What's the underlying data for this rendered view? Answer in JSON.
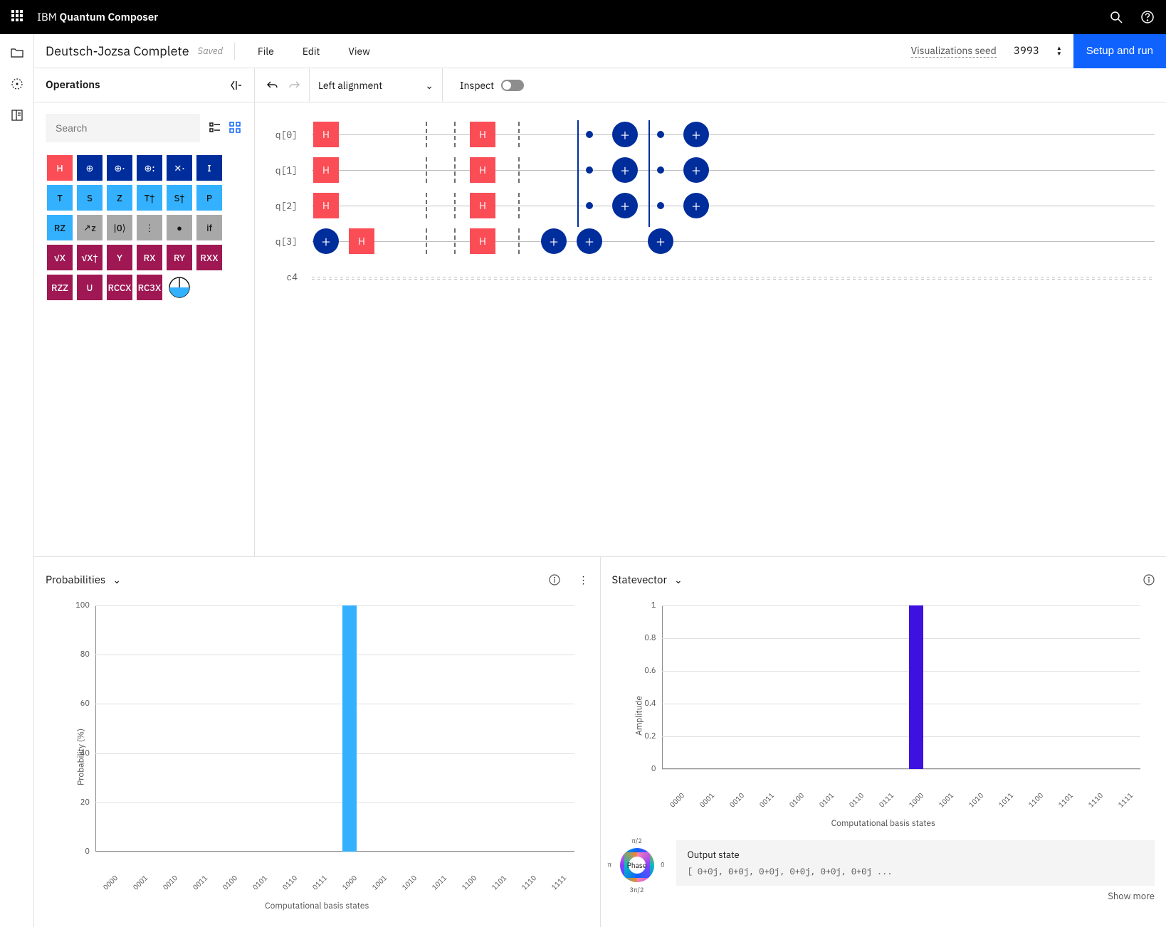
{
  "header": {
    "brand_prefix": "IBM ",
    "brand_main": "Quantum Composer"
  },
  "toolbar": {
    "circuit_name": "Deutsch-Jozsa Complete",
    "saved_label": "Saved",
    "menu": {
      "file": "File",
      "edit": "Edit",
      "view": "View"
    },
    "vis_seed_label": "Visualizations seed",
    "seed_value": "3993",
    "setup_run": "Setup and run"
  },
  "ops": {
    "title": "Operations",
    "search_placeholder": "Search",
    "gates": [
      {
        "l": "H",
        "c": "g-red"
      },
      {
        "l": "⊕",
        "c": "g-navy"
      },
      {
        "l": "⊕·",
        "c": "g-navy"
      },
      {
        "l": "⊕:",
        "c": "g-navy"
      },
      {
        "l": "✕·",
        "c": "g-navy"
      },
      {
        "l": "I",
        "c": "g-navy"
      },
      {
        "l": "T",
        "c": "g-blue"
      },
      {
        "l": "S",
        "c": "g-blue"
      },
      {
        "l": "Z",
        "c": "g-blue"
      },
      {
        "l": "T†",
        "c": "g-blue"
      },
      {
        "l": "S†",
        "c": "g-blue"
      },
      {
        "l": "P",
        "c": "g-blue"
      },
      {
        "l": "RZ",
        "c": "g-blue"
      },
      {
        "l": "↗z",
        "c": "g-grey"
      },
      {
        "l": "|0⟩",
        "c": "g-grey"
      },
      {
        "l": "⋮",
        "c": "g-grey"
      },
      {
        "l": "●",
        "c": "g-grey"
      },
      {
        "l": "if",
        "c": "g-grey"
      },
      {
        "l": "√X",
        "c": "g-mag"
      },
      {
        "l": "√X†",
        "c": "g-mag"
      },
      {
        "l": "Y",
        "c": "g-mag"
      },
      {
        "l": "RX",
        "c": "g-mag"
      },
      {
        "l": "RY",
        "c": "g-mag"
      },
      {
        "l": "RXX",
        "c": "g-mag"
      },
      {
        "l": "RZZ",
        "c": "g-mag"
      },
      {
        "l": "U",
        "c": "g-mag"
      },
      {
        "l": "RCCX",
        "c": "g-mag"
      },
      {
        "l": "RC3X",
        "c": "g-mag"
      }
    ]
  },
  "circuit_toolbar": {
    "alignment": "Left alignment",
    "inspect": "Inspect"
  },
  "circuit": {
    "qubits": [
      "q[0]",
      "q[1]",
      "q[2]",
      "q[3]"
    ],
    "classical": "c4",
    "h_label": "H"
  },
  "panels": {
    "prob_title": "Probabilities",
    "sv_title": "Statevector",
    "output_state_title": "Output state",
    "output_state_vec": "[ 0+0j, 0+0j, 0+0j, 0+0j, 0+0j, 0+0j ...",
    "show_more": "Show more",
    "phase_label": "Phase",
    "phase_ticks": {
      "top": "π/2",
      "left": "π",
      "right": "0",
      "bottom": "3π/2"
    }
  },
  "chart_data": [
    {
      "type": "bar",
      "title": "Probabilities",
      "xlabel": "Computational basis states",
      "ylabel": "Probability (%)",
      "ylim": [
        0,
        100
      ],
      "yticks": [
        0,
        20,
        40,
        60,
        80,
        100
      ],
      "categories": [
        "0000",
        "0001",
        "0010",
        "0011",
        "0100",
        "0101",
        "0110",
        "0111",
        "1000",
        "1001",
        "1010",
        "1011",
        "1100",
        "1101",
        "1110",
        "1111"
      ],
      "values": [
        0,
        0,
        0,
        0,
        0,
        0,
        0,
        0,
        100,
        0,
        0,
        0,
        0,
        0,
        0,
        0
      ]
    },
    {
      "type": "bar",
      "title": "Statevector",
      "xlabel": "Computational basis states",
      "ylabel": "Amplitude",
      "ylim": [
        0,
        1.0
      ],
      "yticks": [
        0.0,
        0.2,
        0.4,
        0.6,
        0.8,
        1.0
      ],
      "categories": [
        "0000",
        "0001",
        "0010",
        "0011",
        "0100",
        "0101",
        "0110",
        "0111",
        "1000",
        "1001",
        "1010",
        "1011",
        "1100",
        "1101",
        "1110",
        "1111"
      ],
      "values": [
        0,
        0,
        0,
        0,
        0,
        0,
        0,
        0,
        1.0,
        0,
        0,
        0,
        0,
        0,
        0,
        0
      ]
    }
  ]
}
